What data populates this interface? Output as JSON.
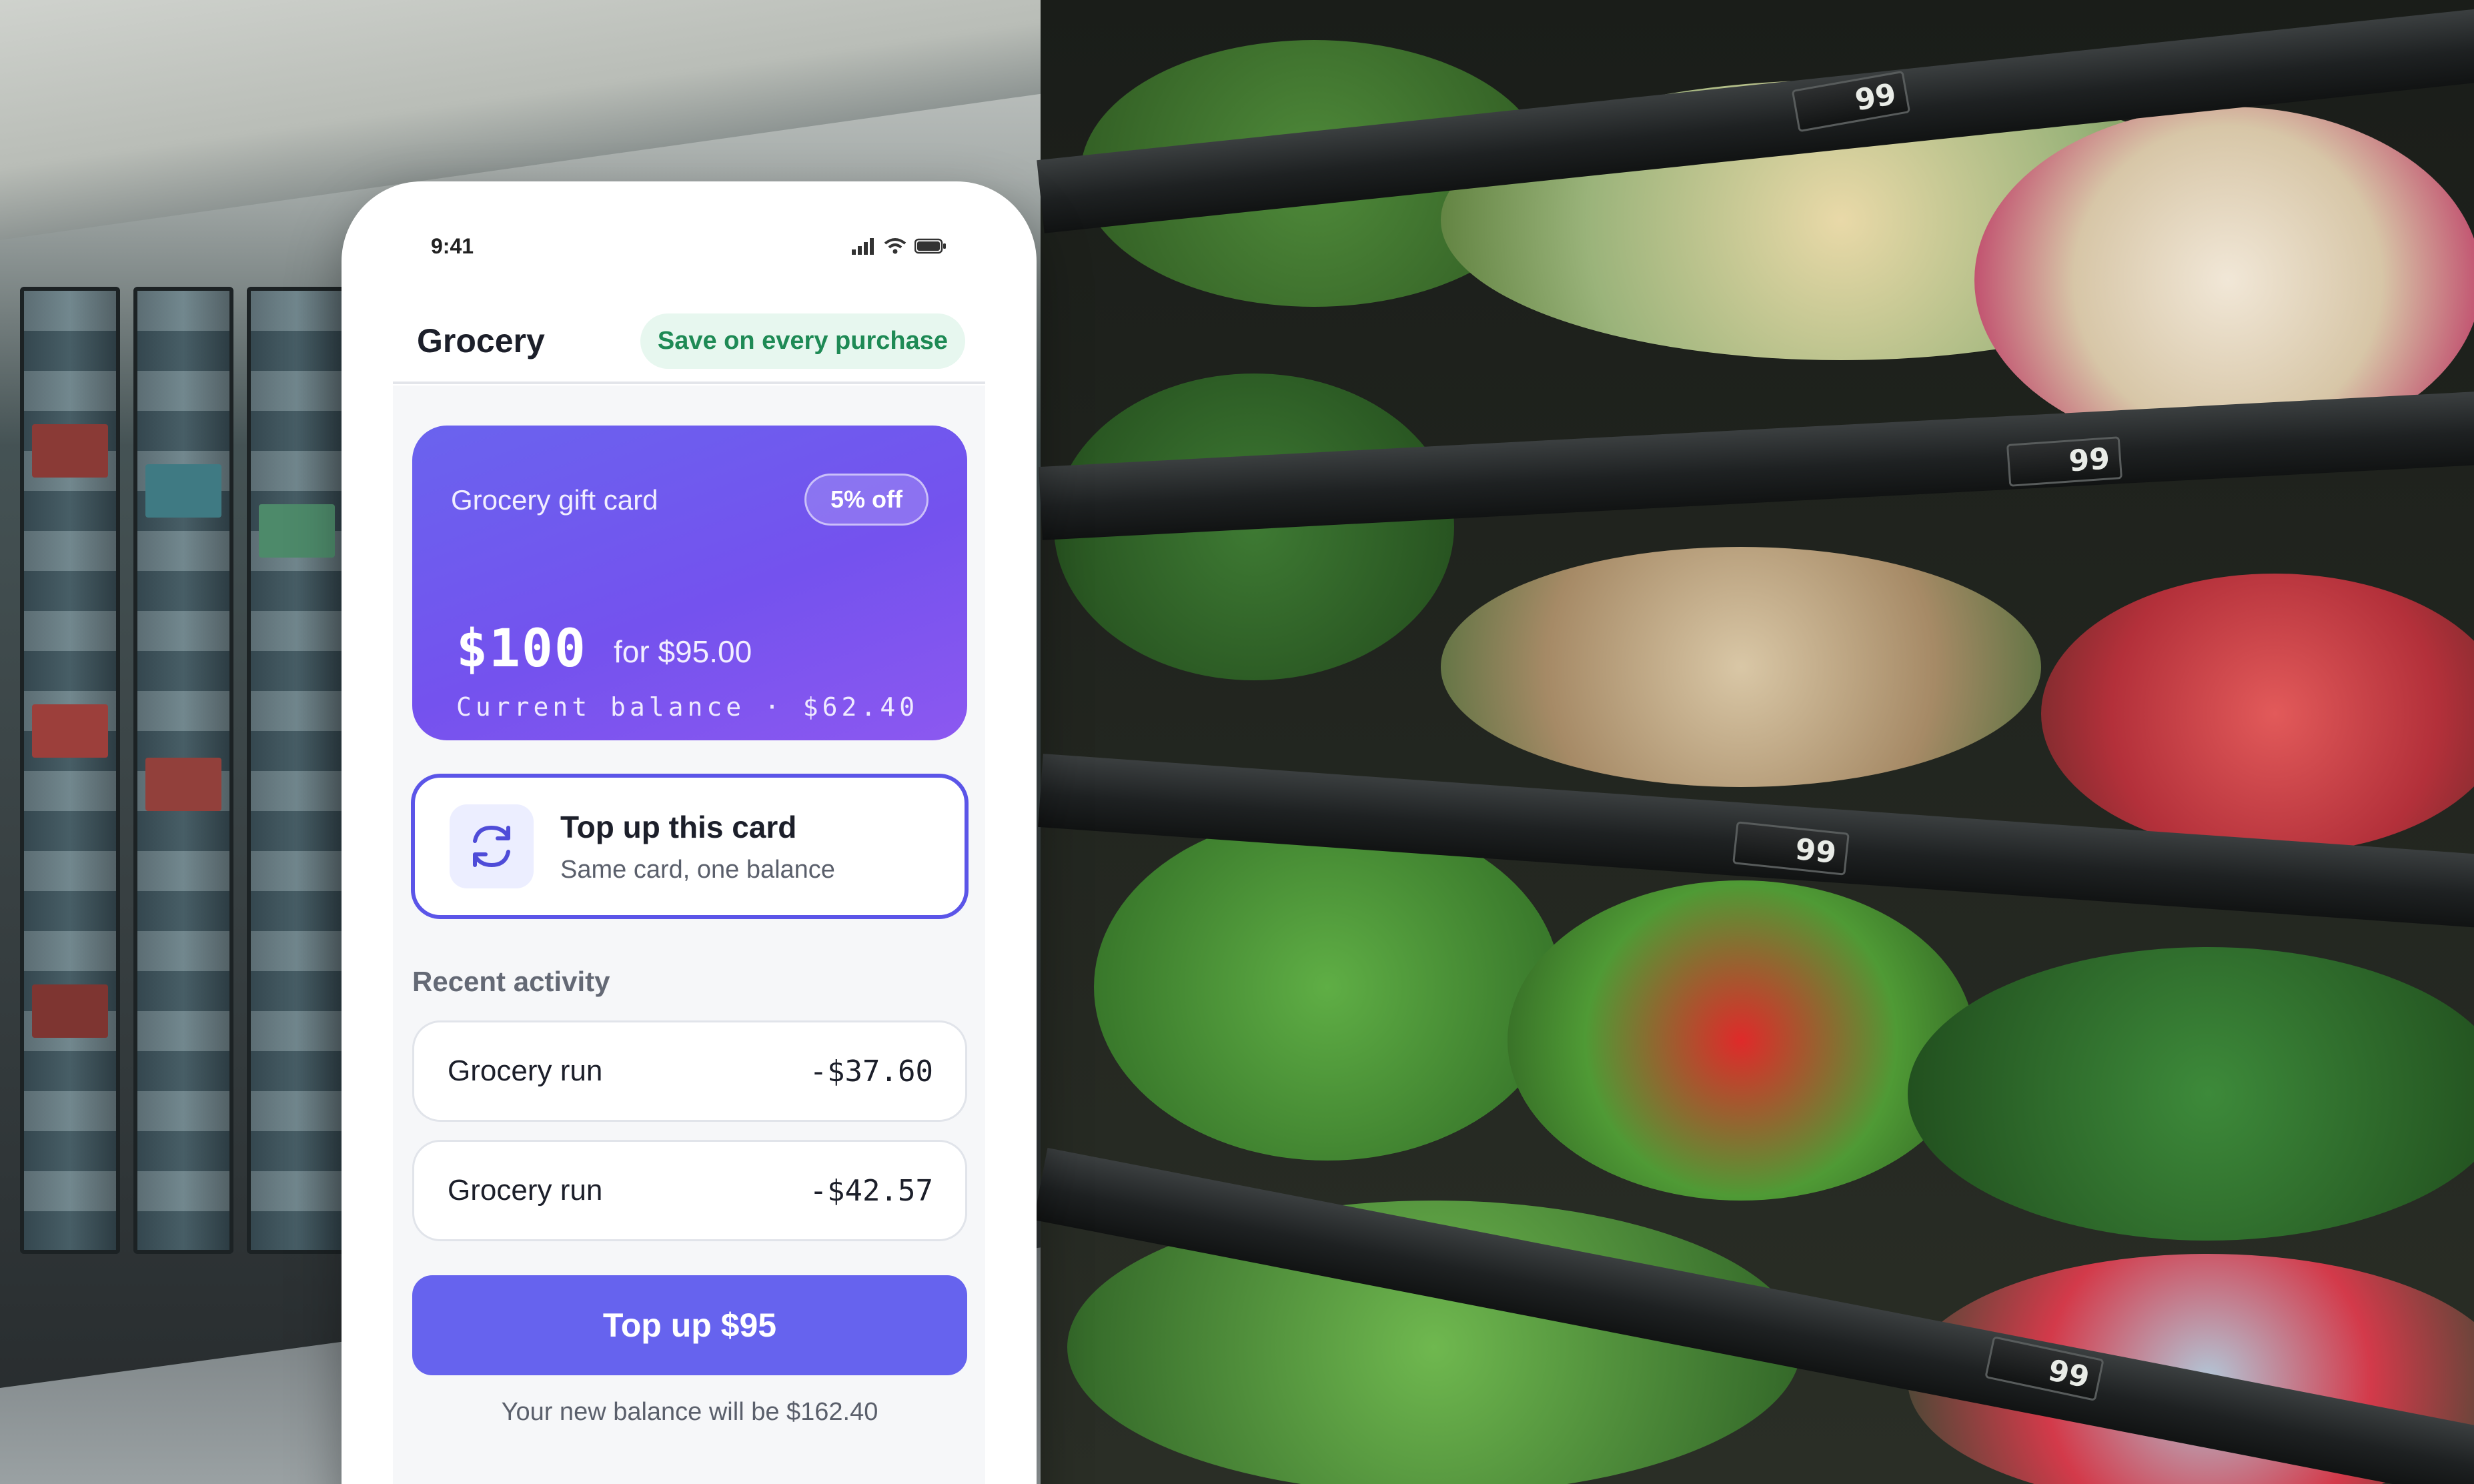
{
  "status_bar": {
    "time": "9:41",
    "icons": [
      "signal-icon",
      "wifi-icon",
      "battery-icon"
    ]
  },
  "header": {
    "title": "Grocery",
    "promo_pill": "Save on every purchase"
  },
  "gift_card": {
    "name": "Grocery gift card",
    "badge": "5% off",
    "amount": "$100",
    "price": "for $95.00",
    "balance": "Current balance · $62.40"
  },
  "topup_option": {
    "icon": "refresh-icon",
    "title": "Top up this card",
    "subtitle": "Same card, one balance"
  },
  "recent_activity": {
    "label": "Recent activity",
    "items": [
      {
        "name": "Grocery run",
        "amount": "-$37.60"
      },
      {
        "name": "Grocery run",
        "amount": "-$42.57"
      }
    ]
  },
  "cta": {
    "label": "Top up $95",
    "note": "Your new balance will be $162.40"
  },
  "colors": {
    "accent": "#6663ee",
    "card_gradient_start": "#6a63ee",
    "card_gradient_end": "#8c58f0",
    "promo_text": "#1e8a55",
    "promo_bg": "#e7f7ef"
  }
}
